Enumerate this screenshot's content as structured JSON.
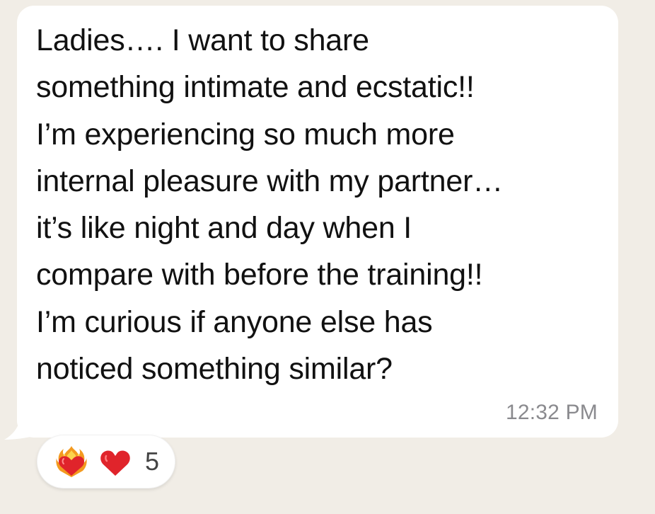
{
  "message": {
    "lines": [
      "Ladies…. I want to share",
      "something intimate and ecstatic!!",
      "I’m experiencing so much more",
      "internal pleasure with my partner…",
      "it’s like night and day when I",
      "compare with before the training!!",
      "I’m curious if anyone else has",
      "noticed something similar?"
    ],
    "timestamp": "12:32 PM"
  },
  "reactions": {
    "emojis": [
      "heart-on-fire-icon",
      "red-heart-icon"
    ],
    "count": "5"
  },
  "colors": {
    "background": "#f1ede6",
    "bubble": "#ffffff",
    "text": "#111111",
    "timestamp": "#8a8a8e",
    "heart_red": "#e0242b"
  }
}
